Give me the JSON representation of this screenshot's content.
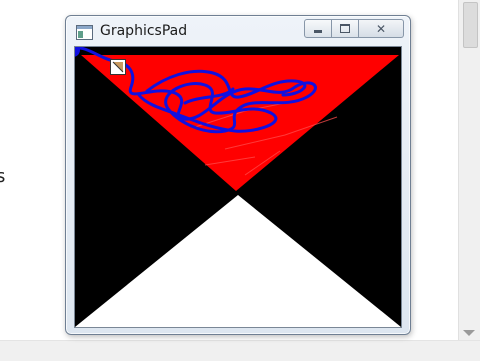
{
  "background": {
    "partial_text": "s"
  },
  "window": {
    "title": "GraphicsPad",
    "controls": {
      "minimize_icon": "minimize-icon",
      "maximize_icon": "maximize-icon",
      "close_icon": "close-icon"
    }
  },
  "canvas": {
    "background_color": "#000000",
    "triangle_top_color": "#ff0000",
    "triangle_bottom_color": "#ffffff",
    "scribble_color": "#1010e0"
  },
  "colors": {
    "title_bar": "#dde6f0",
    "scrollbar": "#f0f0f0"
  }
}
